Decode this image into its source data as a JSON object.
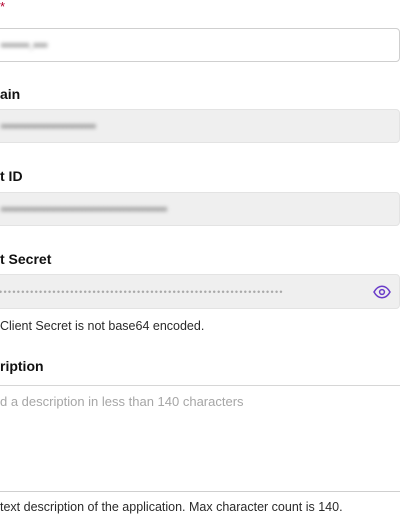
{
  "form": {
    "name_required_marker": "*",
    "name_value": "••••••.•••",
    "domain_label": "ain",
    "domain_value": "••••••••••••••••••••",
    "client_id_label": "t ID",
    "client_id_value": "•••••••••••••••••••••••••••••••••••",
    "client_secret_label": "t Secret",
    "client_secret_masked": "••••••••••••••••••••••••••••••••••••••••••••••••••••••••••••••••",
    "client_secret_toggle_icon": "eye-icon",
    "client_secret_helper": "Client Secret is not base64 encoded.",
    "description_label": "ription",
    "description_placeholder": "d a description in less than 140 characters",
    "description_helper": "text description of the application. Max character count is 140."
  },
  "colors": {
    "accent": "#6a3cc9",
    "required": "#b3002d",
    "readonly_bg": "#efefef"
  }
}
